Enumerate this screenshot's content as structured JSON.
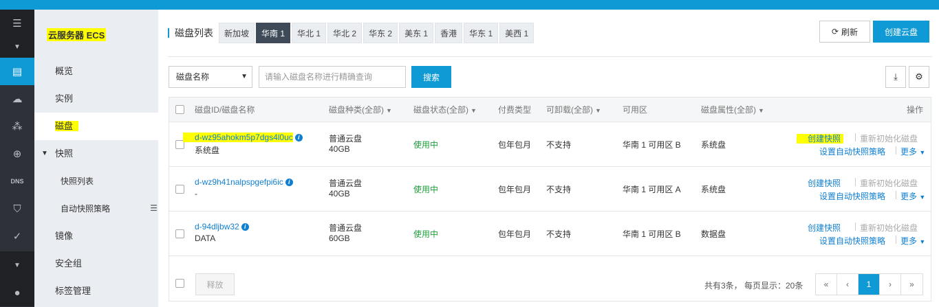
{
  "sidebar": {
    "product_title": "云服务器 ECS",
    "items": [
      {
        "label": "概览"
      },
      {
        "label": "实例"
      },
      {
        "label": "磁盘"
      },
      {
        "label": "快照"
      },
      {
        "label": "快照列表"
      },
      {
        "label": "自动快照策略"
      },
      {
        "label": "镜像"
      },
      {
        "label": "安全组"
      },
      {
        "label": "标签管理"
      }
    ]
  },
  "header": {
    "title": "磁盘列表",
    "regions": [
      "新加坡",
      "华南 1",
      "华北 1",
      "华北 2",
      "华东 2",
      "美东 1",
      "香港",
      "华东 1",
      "美西 1"
    ],
    "active_region": "华南 1",
    "refresh_label": "刷新",
    "create_label": "创建云盘"
  },
  "filter": {
    "select_value": "磁盘名称",
    "search_placeholder": "请输入磁盘名称进行精确查询",
    "search_label": "搜索"
  },
  "table": {
    "columns": {
      "id_name": "磁盘ID/磁盘名称",
      "disk_type": "磁盘种类(全部)",
      "status": "磁盘状态(全部)",
      "billing": "付费类型",
      "detachable": "可卸载(全部)",
      "zone": "可用区",
      "attribute": "磁盘属性(全部)",
      "actions": "操作"
    },
    "rows": [
      {
        "id": "d-wz95ahokm5p7dgs4l0uc",
        "name": "系统盘",
        "type": "普通云盘",
        "size": "40GB",
        "status": "使用中",
        "billing": "包年包月",
        "detachable": "不支持",
        "zone": "华南 1 可用区 B",
        "attribute": "系统盘"
      },
      {
        "id": "d-wz9h41nalpspgefpi6ic",
        "name": "-",
        "type": "普通云盘",
        "size": "40GB",
        "status": "使用中",
        "billing": "包年包月",
        "detachable": "不支持",
        "zone": "华南 1 可用区 A",
        "attribute": "系统盘"
      },
      {
        "id": "d-94dljbw32",
        "name": "DATA",
        "type": "普通云盘",
        "size": "60GB",
        "status": "使用中",
        "billing": "包年包月",
        "detachable": "不支持",
        "zone": "华南 1 可用区 B",
        "attribute": "数据盘"
      }
    ],
    "actions": {
      "snapshot": "创建快照",
      "reinit": "重新初始化磁盘",
      "auto_policy": "设置自动快照策略",
      "more": "更多"
    }
  },
  "footer": {
    "release_label": "释放",
    "total_text": "共有3条， 每页显示：20条",
    "pager": {
      "first": "«",
      "prev": "‹",
      "current": "1",
      "next": "›",
      "last": "»"
    }
  }
}
